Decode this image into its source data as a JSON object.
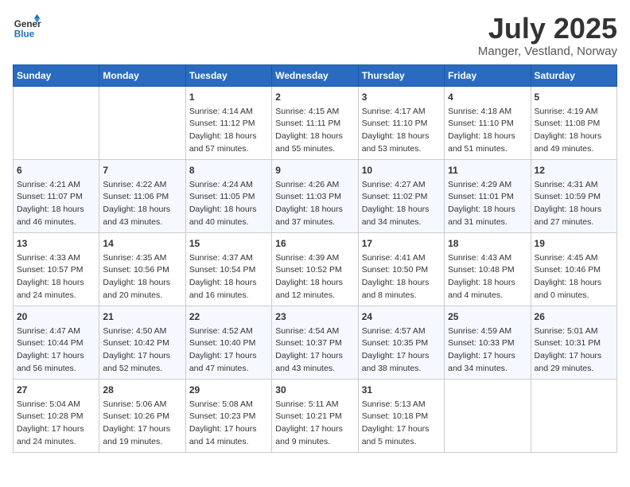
{
  "header": {
    "logo_line1": "General",
    "logo_line2": "Blue",
    "month_year": "July 2025",
    "location": "Manger, Vestland, Norway"
  },
  "days_of_week": [
    "Sunday",
    "Monday",
    "Tuesday",
    "Wednesday",
    "Thursday",
    "Friday",
    "Saturday"
  ],
  "weeks": [
    [
      {
        "day": "",
        "content": ""
      },
      {
        "day": "",
        "content": ""
      },
      {
        "day": "1",
        "content": "Sunrise: 4:14 AM\nSunset: 11:12 PM\nDaylight: 18 hours\nand 57 minutes."
      },
      {
        "day": "2",
        "content": "Sunrise: 4:15 AM\nSunset: 11:11 PM\nDaylight: 18 hours\nand 55 minutes."
      },
      {
        "day": "3",
        "content": "Sunrise: 4:17 AM\nSunset: 11:10 PM\nDaylight: 18 hours\nand 53 minutes."
      },
      {
        "day": "4",
        "content": "Sunrise: 4:18 AM\nSunset: 11:10 PM\nDaylight: 18 hours\nand 51 minutes."
      },
      {
        "day": "5",
        "content": "Sunrise: 4:19 AM\nSunset: 11:08 PM\nDaylight: 18 hours\nand 49 minutes."
      }
    ],
    [
      {
        "day": "6",
        "content": "Sunrise: 4:21 AM\nSunset: 11:07 PM\nDaylight: 18 hours\nand 46 minutes."
      },
      {
        "day": "7",
        "content": "Sunrise: 4:22 AM\nSunset: 11:06 PM\nDaylight: 18 hours\nand 43 minutes."
      },
      {
        "day": "8",
        "content": "Sunrise: 4:24 AM\nSunset: 11:05 PM\nDaylight: 18 hours\nand 40 minutes."
      },
      {
        "day": "9",
        "content": "Sunrise: 4:26 AM\nSunset: 11:03 PM\nDaylight: 18 hours\nand 37 minutes."
      },
      {
        "day": "10",
        "content": "Sunrise: 4:27 AM\nSunset: 11:02 PM\nDaylight: 18 hours\nand 34 minutes."
      },
      {
        "day": "11",
        "content": "Sunrise: 4:29 AM\nSunset: 11:01 PM\nDaylight: 18 hours\nand 31 minutes."
      },
      {
        "day": "12",
        "content": "Sunrise: 4:31 AM\nSunset: 10:59 PM\nDaylight: 18 hours\nand 27 minutes."
      }
    ],
    [
      {
        "day": "13",
        "content": "Sunrise: 4:33 AM\nSunset: 10:57 PM\nDaylight: 18 hours\nand 24 minutes."
      },
      {
        "day": "14",
        "content": "Sunrise: 4:35 AM\nSunset: 10:56 PM\nDaylight: 18 hours\nand 20 minutes."
      },
      {
        "day": "15",
        "content": "Sunrise: 4:37 AM\nSunset: 10:54 PM\nDaylight: 18 hours\nand 16 minutes."
      },
      {
        "day": "16",
        "content": "Sunrise: 4:39 AM\nSunset: 10:52 PM\nDaylight: 18 hours\nand 12 minutes."
      },
      {
        "day": "17",
        "content": "Sunrise: 4:41 AM\nSunset: 10:50 PM\nDaylight: 18 hours\nand 8 minutes."
      },
      {
        "day": "18",
        "content": "Sunrise: 4:43 AM\nSunset: 10:48 PM\nDaylight: 18 hours\nand 4 minutes."
      },
      {
        "day": "19",
        "content": "Sunrise: 4:45 AM\nSunset: 10:46 PM\nDaylight: 18 hours\nand 0 minutes."
      }
    ],
    [
      {
        "day": "20",
        "content": "Sunrise: 4:47 AM\nSunset: 10:44 PM\nDaylight: 17 hours\nand 56 minutes."
      },
      {
        "day": "21",
        "content": "Sunrise: 4:50 AM\nSunset: 10:42 PM\nDaylight: 17 hours\nand 52 minutes."
      },
      {
        "day": "22",
        "content": "Sunrise: 4:52 AM\nSunset: 10:40 PM\nDaylight: 17 hours\nand 47 minutes."
      },
      {
        "day": "23",
        "content": "Sunrise: 4:54 AM\nSunset: 10:37 PM\nDaylight: 17 hours\nand 43 minutes."
      },
      {
        "day": "24",
        "content": "Sunrise: 4:57 AM\nSunset: 10:35 PM\nDaylight: 17 hours\nand 38 minutes."
      },
      {
        "day": "25",
        "content": "Sunrise: 4:59 AM\nSunset: 10:33 PM\nDaylight: 17 hours\nand 34 minutes."
      },
      {
        "day": "26",
        "content": "Sunrise: 5:01 AM\nSunset: 10:31 PM\nDaylight: 17 hours\nand 29 minutes."
      }
    ],
    [
      {
        "day": "27",
        "content": "Sunrise: 5:04 AM\nSunset: 10:28 PM\nDaylight: 17 hours\nand 24 minutes."
      },
      {
        "day": "28",
        "content": "Sunrise: 5:06 AM\nSunset: 10:26 PM\nDaylight: 17 hours\nand 19 minutes."
      },
      {
        "day": "29",
        "content": "Sunrise: 5:08 AM\nSunset: 10:23 PM\nDaylight: 17 hours\nand 14 minutes."
      },
      {
        "day": "30",
        "content": "Sunrise: 5:11 AM\nSunset: 10:21 PM\nDaylight: 17 hours\nand 9 minutes."
      },
      {
        "day": "31",
        "content": "Sunrise: 5:13 AM\nSunset: 10:18 PM\nDaylight: 17 hours\nand 5 minutes."
      },
      {
        "day": "",
        "content": ""
      },
      {
        "day": "",
        "content": ""
      }
    ]
  ]
}
